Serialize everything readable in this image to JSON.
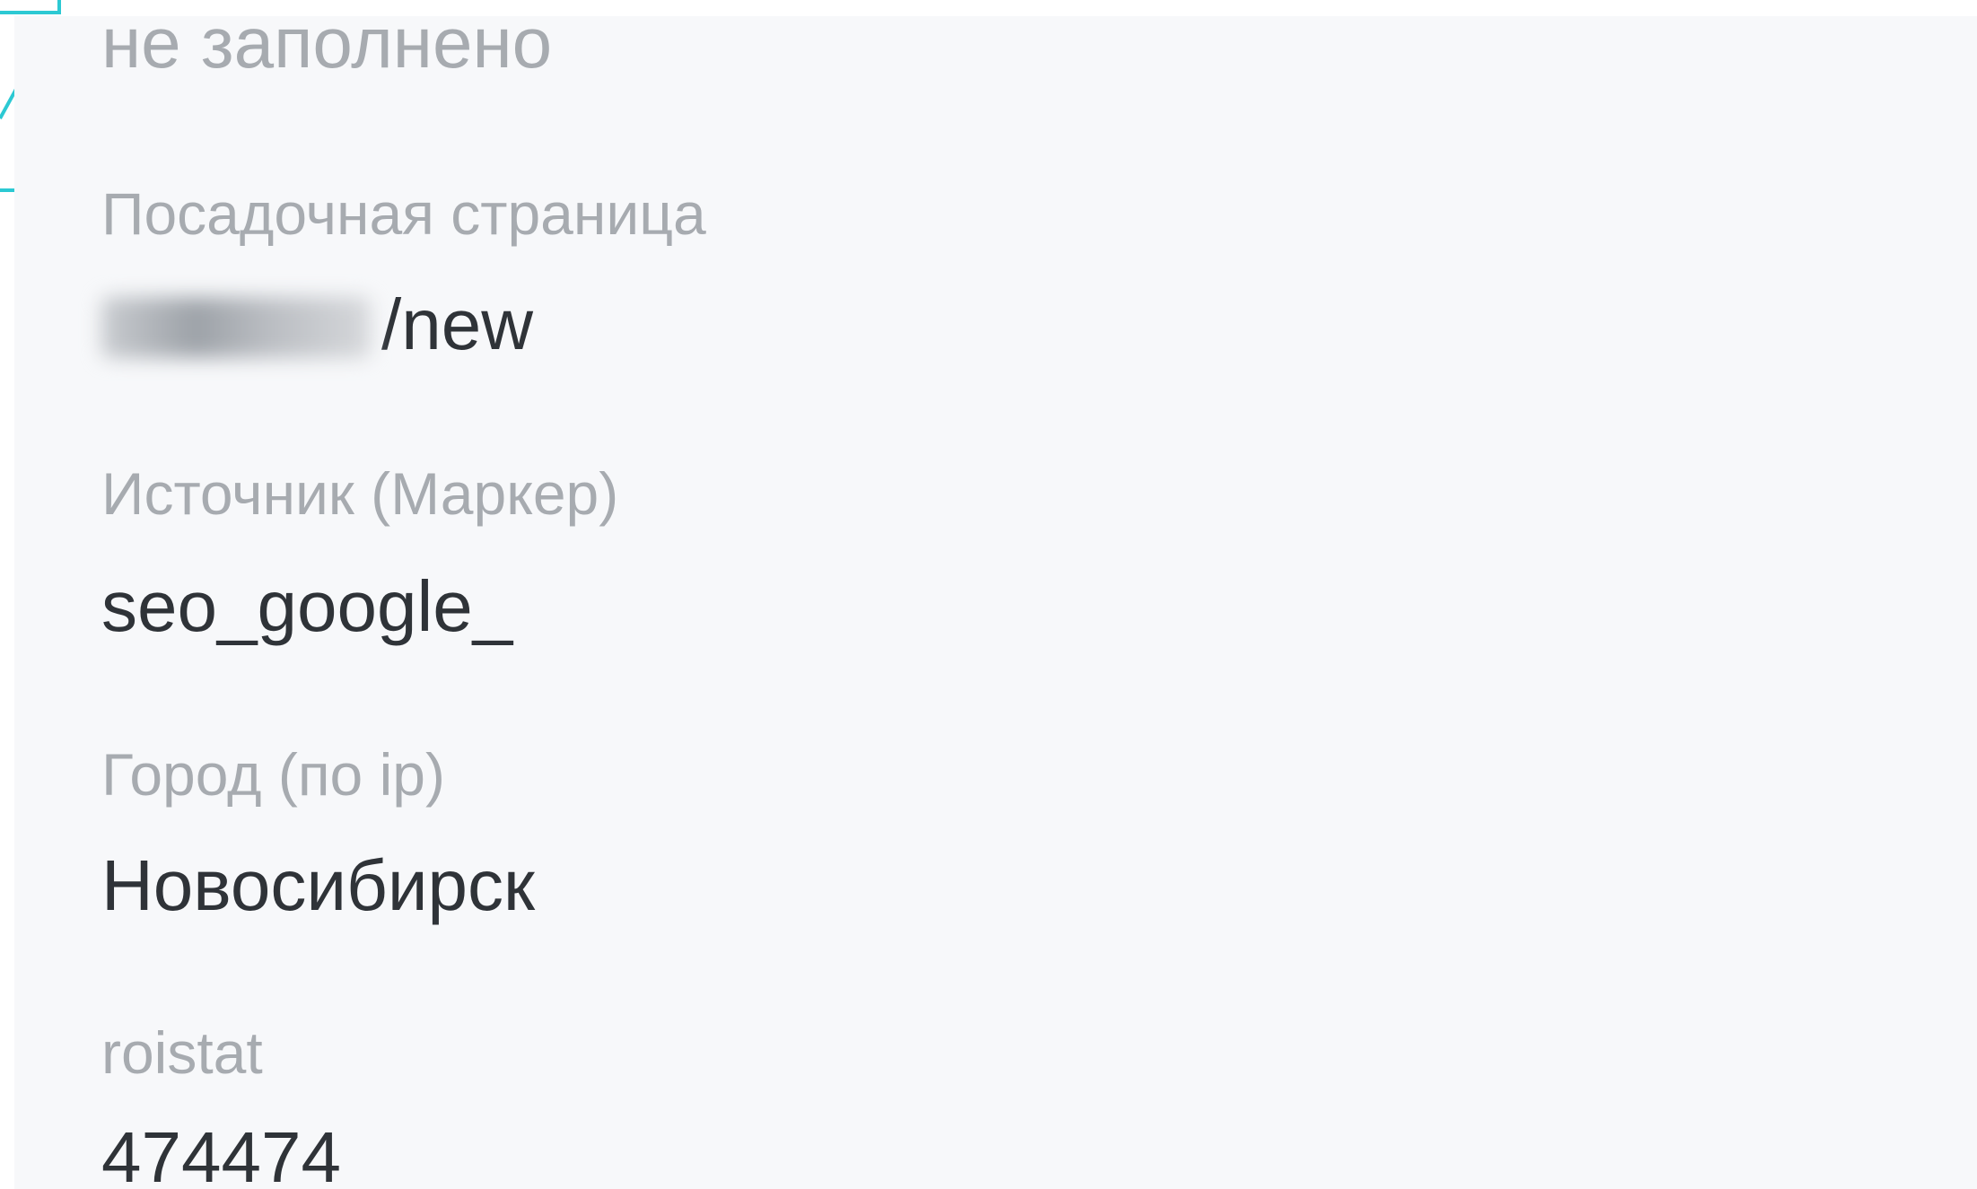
{
  "accent_color": "#2cc9d3",
  "fields": {
    "status": {
      "value": "не заполнено"
    },
    "landing_page": {
      "label": "Посадочная страница",
      "value_suffix": "/new"
    },
    "source": {
      "label": "Источник (Маркер)",
      "value": "seo_google_"
    },
    "city": {
      "label": "Город (по ip)",
      "value": "Новосибирск"
    },
    "roistat": {
      "label": "roistat",
      "value": "474474"
    }
  }
}
